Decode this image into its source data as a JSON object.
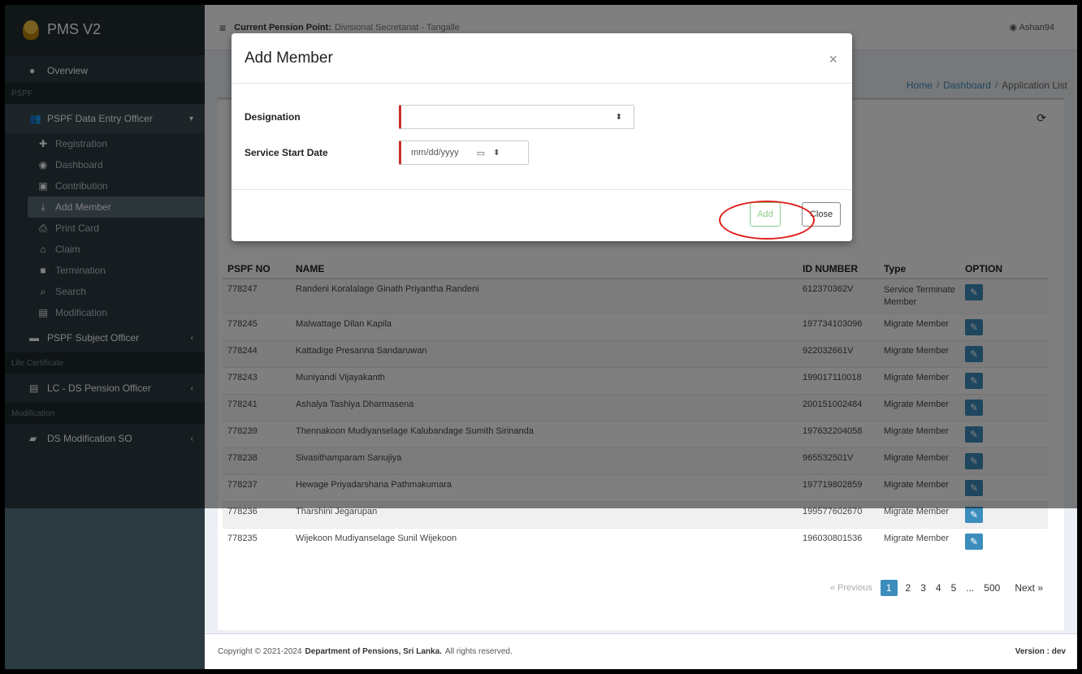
{
  "app": {
    "brand": "PMS V2"
  },
  "header": {
    "menu_icon": "hamburger-icon",
    "pension_point_label": "Current Pension Point:",
    "pension_point_value": "Divisional Secretariat - Tangalle",
    "user": "Ashan94"
  },
  "sidebar": {
    "overview": "Overview",
    "section_pspf": "PSPF",
    "pspf_group": "PSPF Data Entry Officer",
    "items": [
      {
        "label": "Registration",
        "icon": "plus-icon"
      },
      {
        "label": "Dashboard",
        "icon": "dashboard-icon"
      },
      {
        "label": "Contribution",
        "icon": "money-icon"
      },
      {
        "label": "Add Member",
        "icon": "download-icon"
      },
      {
        "label": "Print Card",
        "icon": "print-icon"
      },
      {
        "label": "Claim",
        "icon": "bank-icon"
      },
      {
        "label": "Termination",
        "icon": "stop-icon"
      },
      {
        "label": "Search",
        "icon": "search-icon"
      },
      {
        "label": "Modification",
        "icon": "edit-box-icon"
      }
    ],
    "subject_officer": "PSPF Subject Officer",
    "section_life": "Life Certificate",
    "lc_officer": "LC - DS Pension Officer",
    "section_mod": "Modification",
    "ds_mod": "DS Modification SO"
  },
  "breadcrumb": {
    "home": "Home",
    "dashboard": "Dashboard",
    "current": "Application List"
  },
  "table": {
    "headers": [
      "PSPF NO",
      "NAME",
      "ID NUMBER",
      "Type",
      "OPTION"
    ],
    "rows": [
      {
        "no": "778247",
        "name": "Randeni Koralalage Ginath Priyantha Randeni",
        "id": "612370362V",
        "type": "Service Terminate Member"
      },
      {
        "no": "778245",
        "name": "Malwattage Dilan Kapila",
        "id": "197734103096",
        "type": "Migrate Member"
      },
      {
        "no": "778244",
        "name": "Kattadige Presanna Sandaruwan",
        "id": "922032661V",
        "type": "Migrate Member"
      },
      {
        "no": "778243",
        "name": "Muniyandi Vijayakanth",
        "id": "199017110018",
        "type": "Migrate Member"
      },
      {
        "no": "778241",
        "name": "Ashalya Tashiya Dharmasena",
        "id": "200151002484",
        "type": "Migrate Member"
      },
      {
        "no": "778239",
        "name": "Thennakoon Mudiyanselage Kalubandage Sumith Sirinanda",
        "id": "197632204058",
        "type": "Migrate Member"
      },
      {
        "no": "778238",
        "name": "Sivasithamparam Sanujiya",
        "id": "965532501V",
        "type": "Migrate Member"
      },
      {
        "no": "778237",
        "name": "Hewage Priyadarshana Pathmakumara",
        "id": "197719802859",
        "type": "Migrate Member"
      },
      {
        "no": "778236",
        "name": "Tharshini Jegarupan",
        "id": "199577602670",
        "type": "Migrate Member"
      },
      {
        "no": "778235",
        "name": "Wijekoon Mudiyanselage Sunil Wijekoon",
        "id": "196030801536",
        "type": "Migrate Member"
      }
    ]
  },
  "pagination": {
    "previous": "« Previous",
    "pages": [
      "1",
      "2",
      "3",
      "4",
      "5",
      "...",
      "500"
    ],
    "current": "1",
    "next": "Next »"
  },
  "footer": {
    "prefix": "Copyright © 2021-2024",
    "org": "Department of Pensions, Sri Lanka.",
    "suffix": "All rights reserved.",
    "version": "Version : dev"
  },
  "modal": {
    "title": "Add Member",
    "designation_label": "Designation",
    "designation_value": "",
    "service_start_label": "Service Start Date",
    "date_placeholder": "mm/dd/yyyy",
    "add_label": "Add",
    "close_label": "Close"
  }
}
